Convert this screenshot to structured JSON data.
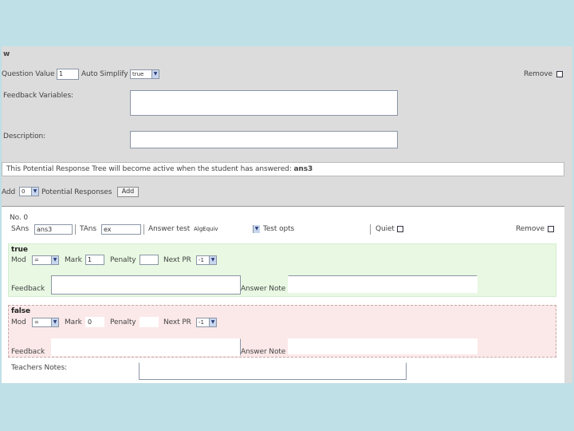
{
  "header": {
    "title": "w"
  },
  "question": {
    "value_label": "Question Value",
    "value": "1",
    "auto_simplify_label": "Auto Simplify",
    "auto_simplify_value": "true",
    "remove_label": "Remove",
    "feedback_variables_label": "Feedback Variables:",
    "feedback_variables_value": "",
    "description_label": "Description:",
    "description_value": ""
  },
  "prt_notice": {
    "text": "This Potential Response Tree will become active when the student has answered:",
    "answer": "ans3"
  },
  "add_bar": {
    "add_label": "Add",
    "count_value": "0",
    "potential_responses_label": "Potential Responses",
    "add_button": "Add"
  },
  "node": {
    "title": "No. 0",
    "sans_label": "SAns",
    "sans_value": "ans3",
    "tans_label": "TAns",
    "tans_value": "ex",
    "answer_test_label": "Answer test",
    "answer_test_value": "AlgEquiv",
    "test_opts_label": "Test opts",
    "quiet_label": "Quiet",
    "remove_label": "Remove",
    "teachers_notes_label": "Teachers Notes:",
    "teachers_notes_value": "",
    "true_branch": {
      "title": "true",
      "mod_label": "Mod",
      "mod_value": "=",
      "mark_label": "Mark",
      "mark_value": "1",
      "penalty_label": "Penalty",
      "penalty_value": "",
      "next_pr_label": "Next PR",
      "next_pr_value": "-1",
      "feedback_label": "Feedback",
      "feedback_value": "",
      "answer_note_label": "Answer Note",
      "answer_note_value": ""
    },
    "false_branch": {
      "title": "false",
      "mod_label": "Mod",
      "mod_value": "=",
      "mark_label": "Mark",
      "mark_value": "0",
      "penalty_label": "Penalty",
      "penalty_value": "",
      "next_pr_label": "Next PR",
      "next_pr_value": "-1",
      "feedback_label": "Feedback",
      "feedback_value": "",
      "answer_note_label": "Answer Note",
      "answer_note_value": ""
    }
  },
  "colors": {
    "outer_background": "#bfe0e6",
    "panel_background": "#dcdcdc",
    "true_branch_background": "#e8f8e2",
    "false_branch_background": "#fbe8e8"
  }
}
